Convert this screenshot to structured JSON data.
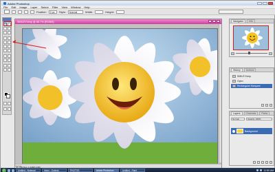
{
  "window": {
    "title": "Adobe Photoshop"
  },
  "menu": [
    "File",
    "Edit",
    "Image",
    "Layer",
    "Select",
    "Filter",
    "View",
    "Window",
    "Help"
  ],
  "options": {
    "feather_label": "Feather:",
    "feather_value": "0 px",
    "style_label": "Style:",
    "style_value": "Normal",
    "width_label": "Width:",
    "height_label": "Height:"
  },
  "document": {
    "title": "SMILEY.bmp @ 66.7% (RGB/8)"
  },
  "status": {
    "zoom": "66.67%",
    "doc_info": "Doc: 1.44M/1.44M"
  },
  "panels": {
    "navigator": {
      "tabs": [
        "Navigator",
        "Info"
      ]
    },
    "history": {
      "tabs": [
        "History",
        "Actions"
      ],
      "items": [
        "SMILEY.bmp",
        "Open",
        "Rectangular Marquee"
      ]
    },
    "layers": {
      "tabs": [
        "Layers",
        "Channels",
        "Paths"
      ],
      "blend_mode": "Normal",
      "opacity": "Opacity: 100%",
      "layer_name": "Background"
    }
  },
  "taskbar": {
    "items": [
      "Untitled - Notepad",
      "Inbox - Outlook",
      "PHOTOS",
      "Adobe Photoshop",
      "Untitled - Paint"
    ],
    "clock": "11:50 AM"
  },
  "colors": {
    "doc_title_pink": "#dd55ad",
    "selection_blue": "#3b6bb5",
    "annotation_red": "#d31b1b"
  },
  "icons": {
    "toolbox": [
      "marquee-icon",
      "move-icon",
      "lasso-icon",
      "magic-wand-icon",
      "crop-icon",
      "slice-icon",
      "healing-icon",
      "brush-icon",
      "stamp-icon",
      "history-brush-icon",
      "eraser-icon",
      "gradient-icon",
      "blur-icon",
      "dodge-icon",
      "path-icon",
      "type-icon",
      "pen-icon",
      "shape-icon",
      "notes-icon",
      "eyedropper-icon",
      "hand-icon",
      "zoom-icon"
    ]
  }
}
